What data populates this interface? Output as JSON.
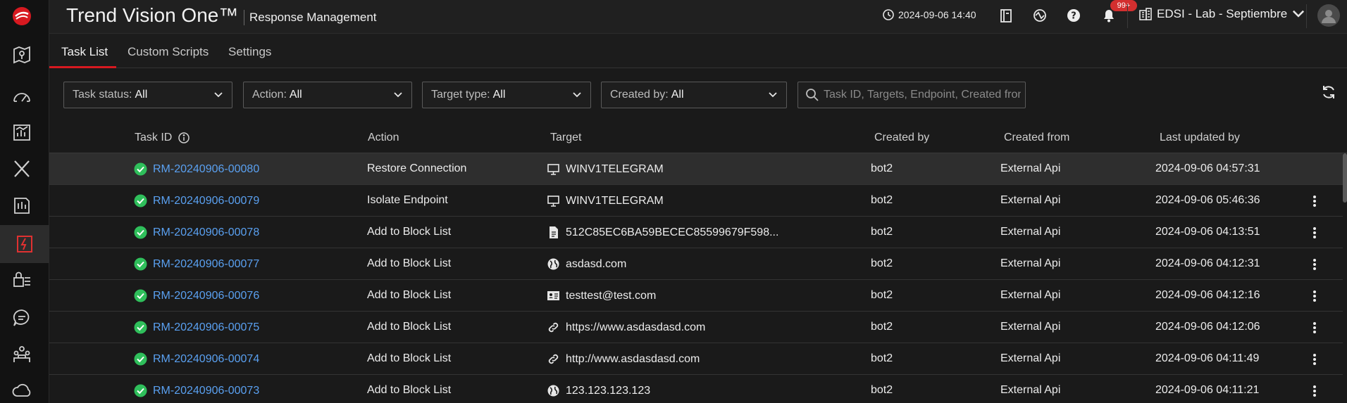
{
  "header": {
    "brand": "Trend Vision One™",
    "module": "Response Management",
    "datetime": "2024-09-06 14:40",
    "notifications_badge": "99+",
    "tenant": "EDSI - Lab - Septiembre"
  },
  "tabs": [
    {
      "label": "Task List",
      "active": true
    },
    {
      "label": "Custom Scripts",
      "active": false
    },
    {
      "label": "Settings",
      "active": false
    }
  ],
  "filters": {
    "task_status": {
      "label": "Task status:",
      "value": "All"
    },
    "action": {
      "label": "Action:",
      "value": "All"
    },
    "target_type": {
      "label": "Target type:",
      "value": "All"
    },
    "created_by": {
      "label": "Created by:",
      "value": "All"
    },
    "search_placeholder": "Task ID, Targets, Endpoint, Created from"
  },
  "table": {
    "columns": {
      "task_id": "Task ID",
      "action": "Action",
      "target": "Target",
      "created_by": "Created by",
      "created_from": "Created from",
      "last_updated_by": "Last updated by"
    },
    "rows": [
      {
        "id": "RM-20240906-00080",
        "action": "Restore Connection",
        "target_icon": "endpoint-icon",
        "target": "WINV1TELEGRAM",
        "by": "bot2",
        "from": "External Api",
        "updated": "2024-09-06 04:57:31"
      },
      {
        "id": "RM-20240906-00079",
        "action": "Isolate Endpoint",
        "target_icon": "endpoint-icon",
        "target": "WINV1TELEGRAM",
        "by": "bot2",
        "from": "External Api",
        "updated": "2024-09-06 05:46:36"
      },
      {
        "id": "RM-20240906-00078",
        "action": "Add to Block List",
        "target_icon": "file-icon",
        "target": "512C85EC6BA59BECEC85599679F598...",
        "by": "bot2",
        "from": "External Api",
        "updated": "2024-09-06 04:13:51"
      },
      {
        "id": "RM-20240906-00077",
        "action": "Add to Block List",
        "target_icon": "globe-icon",
        "target": "asdasd.com",
        "by": "bot2",
        "from": "External Api",
        "updated": "2024-09-06 04:12:31"
      },
      {
        "id": "RM-20240906-00076",
        "action": "Add to Block List",
        "target_icon": "id-card-icon",
        "target": "testtest@test.com",
        "by": "bot2",
        "from": "External Api",
        "updated": "2024-09-06 04:12:16"
      },
      {
        "id": "RM-20240906-00075",
        "action": "Add to Block List",
        "target_icon": "link-icon",
        "target": "https://www.asdasdasd.com",
        "by": "bot2",
        "from": "External Api",
        "updated": "2024-09-06 04:12:06"
      },
      {
        "id": "RM-20240906-00074",
        "action": "Add to Block List",
        "target_icon": "link-icon",
        "target": "http://www.asdasdasd.com",
        "by": "bot2",
        "from": "External Api",
        "updated": "2024-09-06 04:11:49"
      },
      {
        "id": "RM-20240906-00073",
        "action": "Add to Block List",
        "target_icon": "globe-icon",
        "target": "123.123.123.123",
        "by": "bot2",
        "from": "External Api",
        "updated": "2024-09-06 04:11:21"
      }
    ]
  },
  "colors": {
    "accent_red": "#d71920",
    "link_blue": "#5aa0f0",
    "success_green": "#2fbf5b"
  }
}
